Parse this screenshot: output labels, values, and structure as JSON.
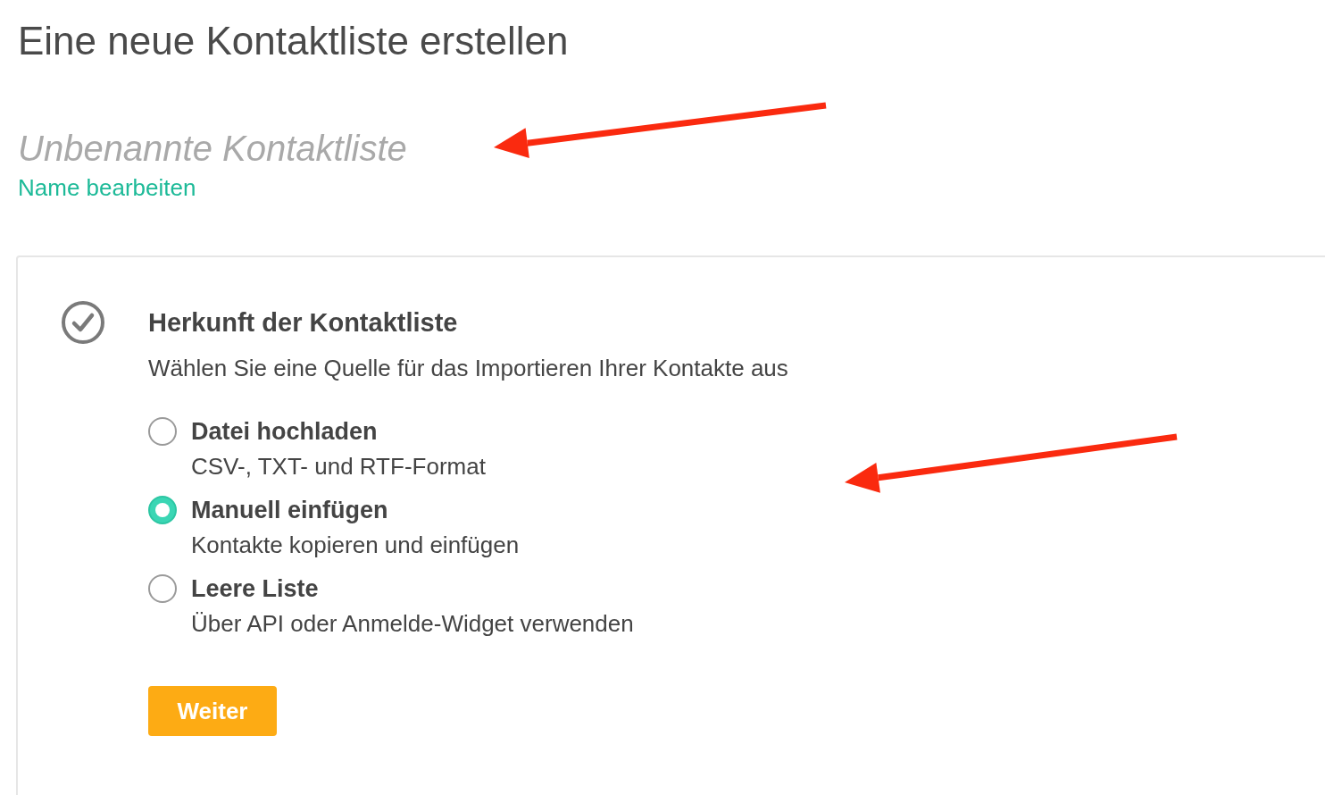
{
  "title": "Eine neue Kontaktliste erstellen",
  "list_name": "Unbenannte Kontaktliste",
  "edit_link": "Name bearbeiten",
  "source_section": {
    "heading": "Herkunft der Kontaktliste",
    "description": "Wählen Sie eine Quelle für das Importieren Ihrer Kontakte aus",
    "options": [
      {
        "title": "Datei hochladen",
        "description": "CSV-, TXT- und RTF-Format",
        "selected": false
      },
      {
        "title": "Manuell einfügen",
        "description": "Kontakte kopieren und einfügen",
        "selected": true
      },
      {
        "title": "Leere Liste",
        "description": "Über API oder Anmelde-Widget verwenden",
        "selected": false
      }
    ],
    "button": "Weiter"
  }
}
